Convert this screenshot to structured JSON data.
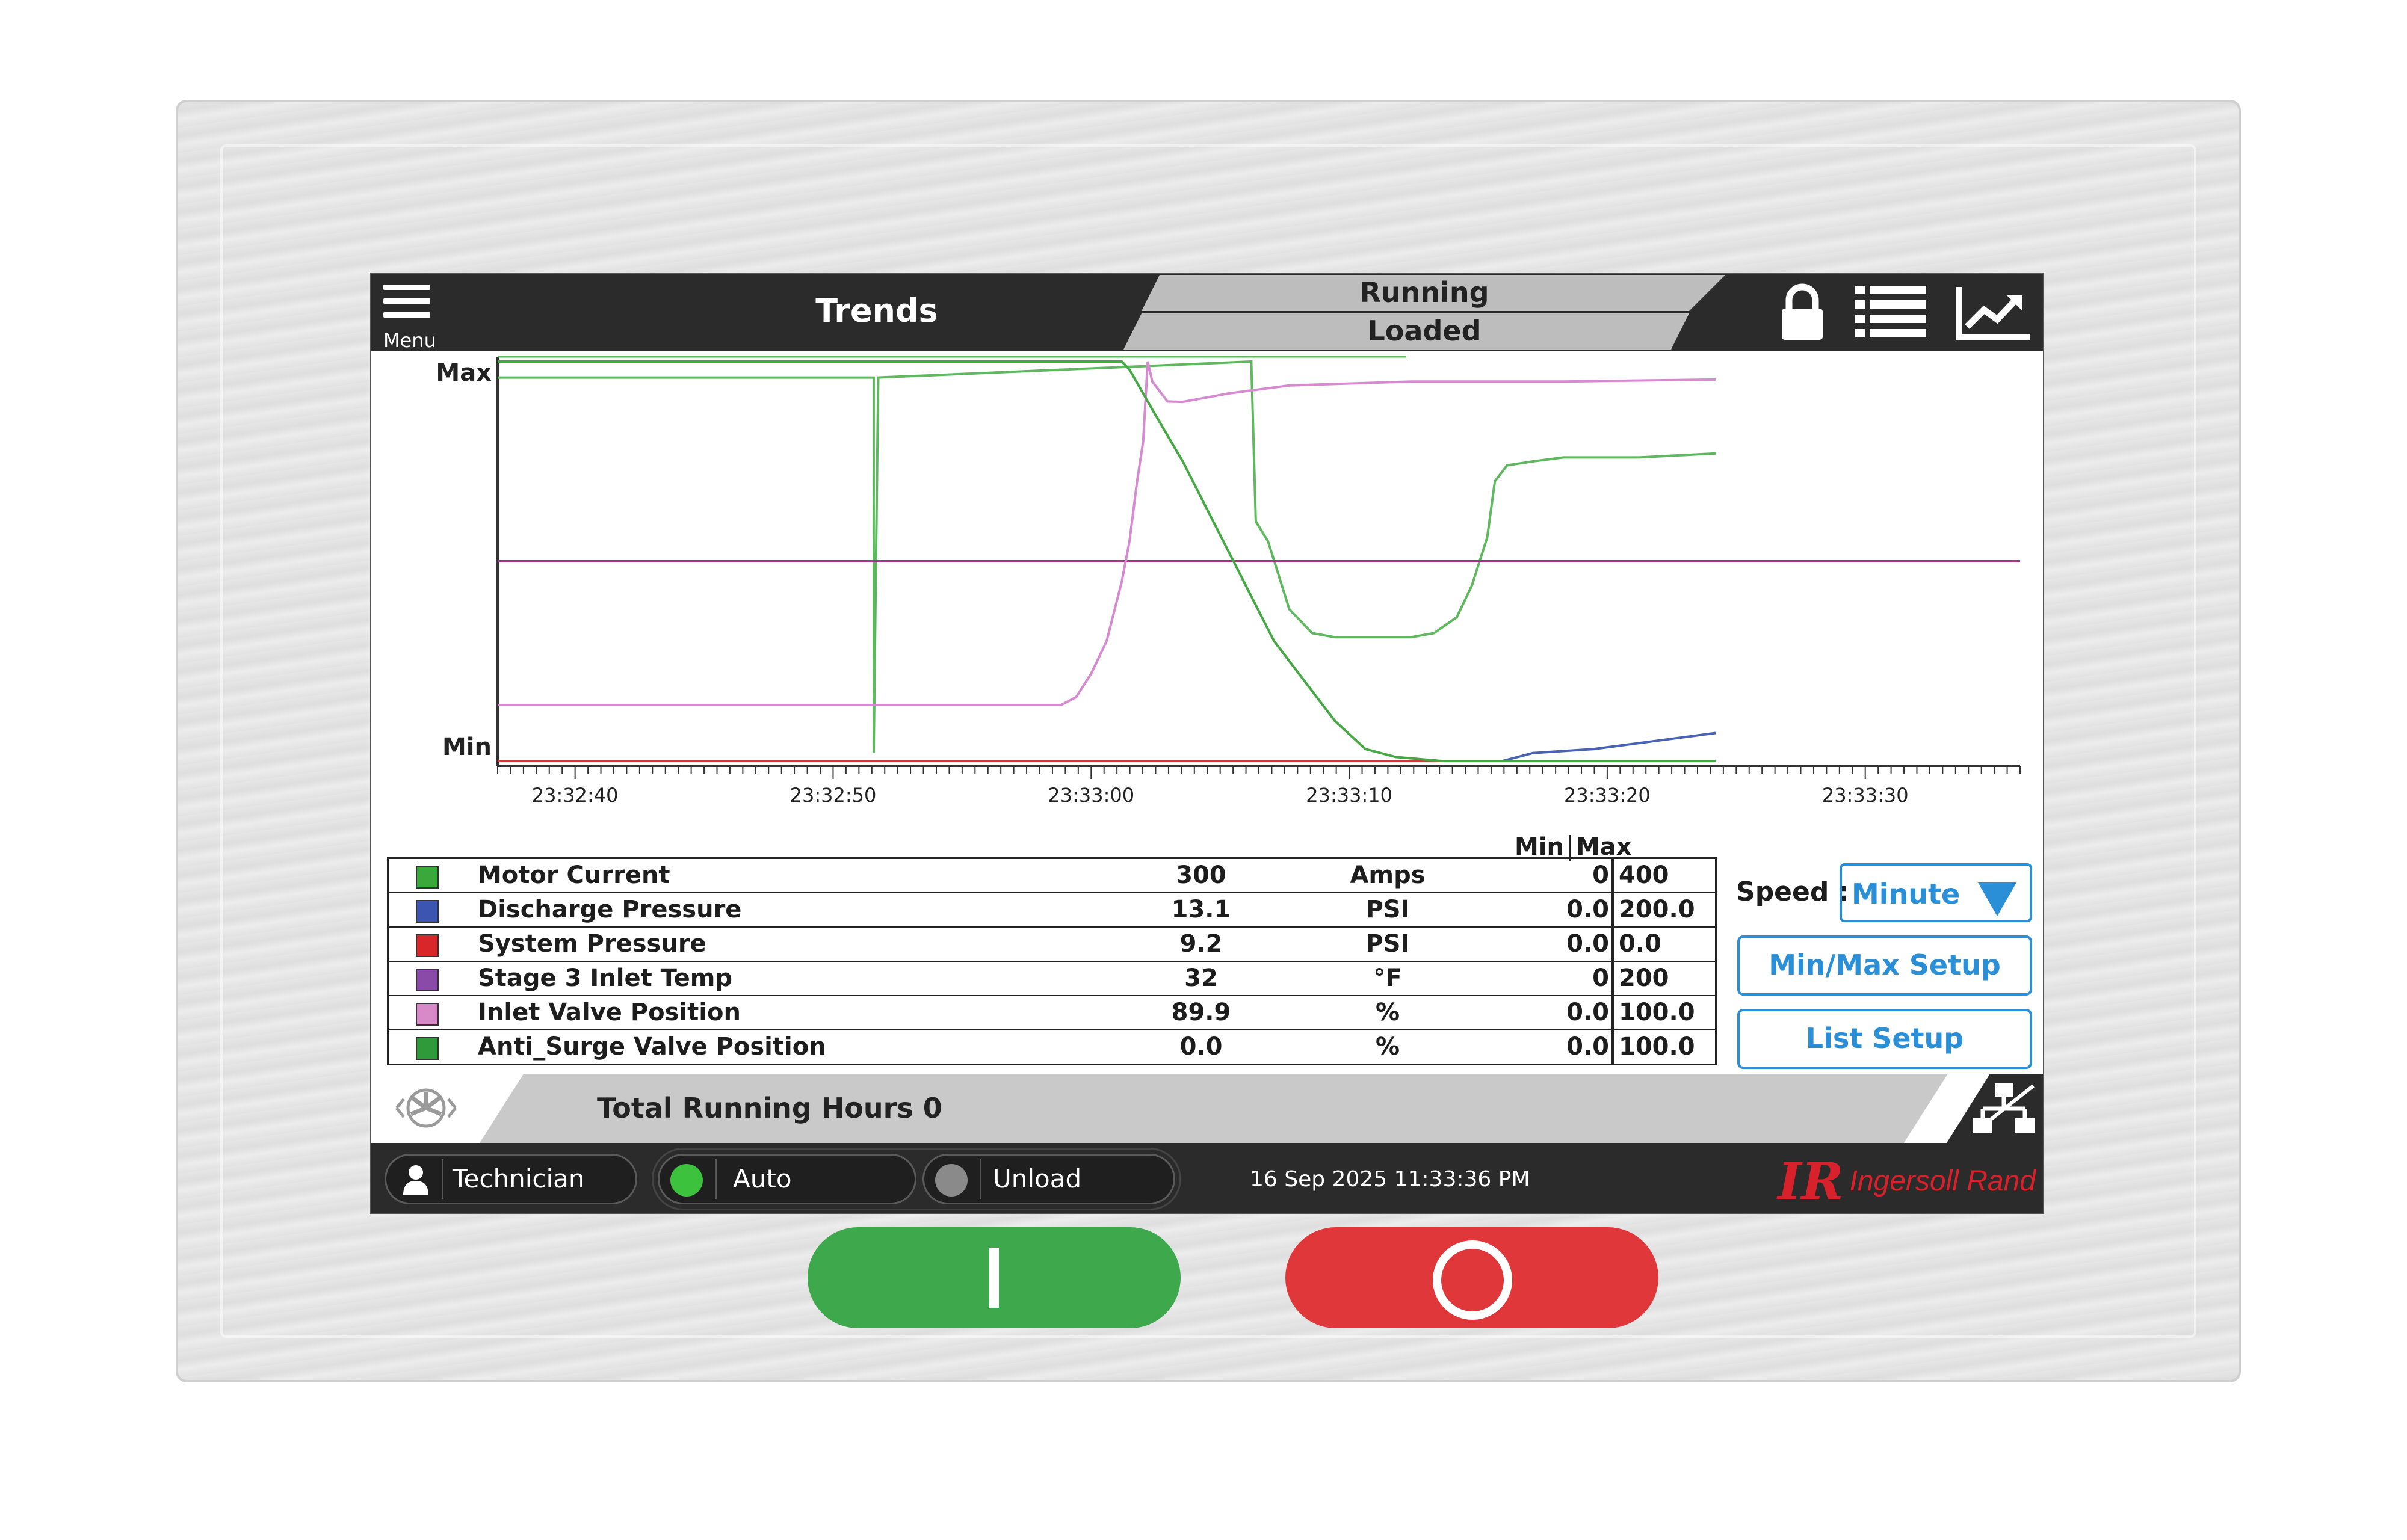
{
  "header": {
    "menu_label": "Menu",
    "title": "Trends",
    "status_running": "Running",
    "status_loaded": "Loaded",
    "icons": [
      "lock-icon",
      "list-icon",
      "trend-chart-icon"
    ]
  },
  "chart_data": {
    "type": "line",
    "y_top_label": "Max",
    "y_bottom_label": "Min",
    "x_tick_labels": [
      "23:32:40",
      "23:32:50",
      "23:33:00",
      "23:33:10",
      "23:33:20",
      "23:33:30"
    ],
    "x_range": [
      "23:32:37",
      "23:33:36"
    ],
    "y_range_percent": [
      0,
      100
    ],
    "grid": false,
    "series": [
      {
        "name": "Motor Current",
        "color": "#5fb85f",
        "points": [
          [
            0,
            96
          ],
          [
            24.7,
            96
          ],
          [
            24.7,
            2
          ],
          [
            25,
            96
          ],
          [
            49.5,
            100
          ],
          [
            49.8,
            60
          ],
          [
            50.6,
            55
          ],
          [
            52,
            38
          ],
          [
            53.5,
            32
          ],
          [
            55,
            31
          ],
          [
            57,
            31
          ],
          [
            60,
            31
          ],
          [
            61.5,
            32
          ],
          [
            63,
            36
          ],
          [
            64,
            44
          ],
          [
            65,
            56
          ],
          [
            65.5,
            70
          ],
          [
            66.3,
            74
          ],
          [
            68,
            75
          ],
          [
            70,
            76
          ],
          [
            75,
            76
          ],
          [
            80,
            77
          ]
        ]
      },
      {
        "name": "Discharge Pressure",
        "color": "#4a62b4",
        "points": [
          [
            0,
            0
          ],
          [
            66,
            0
          ],
          [
            68,
            2
          ],
          [
            72,
            3
          ],
          [
            76,
            5
          ],
          [
            80,
            7
          ]
        ]
      },
      {
        "name": "System Pressure",
        "color": "#d13a3a",
        "points": [
          [
            0,
            0
          ],
          [
            80,
            0
          ]
        ]
      },
      {
        "name": "Stage 3 Inlet Temp",
        "color": "#9a3f7f",
        "points": [
          [
            0,
            50
          ],
          [
            100,
            50
          ]
        ]
      },
      {
        "name": "Inlet Valve Position",
        "color": "#d68ad0",
        "points": [
          [
            0,
            14
          ],
          [
            37,
            14
          ],
          [
            38,
            16
          ],
          [
            39,
            22
          ],
          [
            40,
            30
          ],
          [
            41,
            45
          ],
          [
            41.5,
            55
          ],
          [
            42,
            70
          ],
          [
            42.4,
            80
          ],
          [
            42.7,
            100
          ],
          [
            43,
            95
          ],
          [
            44,
            90
          ],
          [
            45,
            89.9
          ],
          [
            48,
            92
          ],
          [
            52,
            94
          ],
          [
            60,
            95
          ],
          [
            70,
            95
          ],
          [
            80,
            95.5
          ]
        ]
      },
      {
        "name": "Anti_Surge Valve Position",
        "color": "#45a845",
        "points": [
          [
            0,
            100
          ],
          [
            41,
            100
          ],
          [
            41.5,
            98
          ],
          [
            43,
            88
          ],
          [
            45,
            75
          ],
          [
            47,
            60
          ],
          [
            49,
            45
          ],
          [
            51,
            30
          ],
          [
            53,
            20
          ],
          [
            55,
            10
          ],
          [
            57,
            3
          ],
          [
            59,
            1
          ],
          [
            62,
            0
          ],
          [
            80,
            0
          ]
        ]
      }
    ]
  },
  "legend": {
    "min_header": "Min",
    "max_header": "Max",
    "rows": [
      {
        "name": "Motor Current",
        "value": "300",
        "unit": "Amps",
        "min": "0",
        "max": "400",
        "color": "#3aa83a"
      },
      {
        "name": "Discharge Pressure",
        "value": "13.1",
        "unit": "PSI",
        "min": "0.0",
        "max": "200.0",
        "color": "#3b55b0"
      },
      {
        "name": "System Pressure",
        "value": "9.2",
        "unit": "PSI",
        "min": "0.0",
        "max": "0.0",
        "color": "#d9262b"
      },
      {
        "name": "Stage 3 Inlet Temp",
        "value": "32",
        "unit": "°F",
        "min": "0",
        "max": "200",
        "color": "#8a4aa8"
      },
      {
        "name": "Inlet Valve Position",
        "value": "89.9",
        "unit": "%",
        "min": "0.0",
        "max": "100.0",
        "color": "#d889c8"
      },
      {
        "name": "Anti_Surge Valve Position",
        "value": "0.0",
        "unit": "%",
        "min": "0.0",
        "max": "100.0",
        "color": "#2f9a3a"
      }
    ]
  },
  "controls": {
    "speed_label": "Speed :",
    "speed_value": "Minute",
    "minmax_button": "Min/Max Setup",
    "list_button": "List Setup"
  },
  "hours": {
    "text": "Total Running Hours 0"
  },
  "footer": {
    "user": "Technician",
    "mode": "Auto",
    "mode_indicator_color": "#3cc23c",
    "load_state": "Unload",
    "load_indicator_color": "#8a8a8a",
    "datetime": "16 Sep 2025  11:33:36 PM",
    "logo_mark": "IR",
    "logo_text": "Ingersoll Rand",
    "logo_color": "#d8222b"
  }
}
